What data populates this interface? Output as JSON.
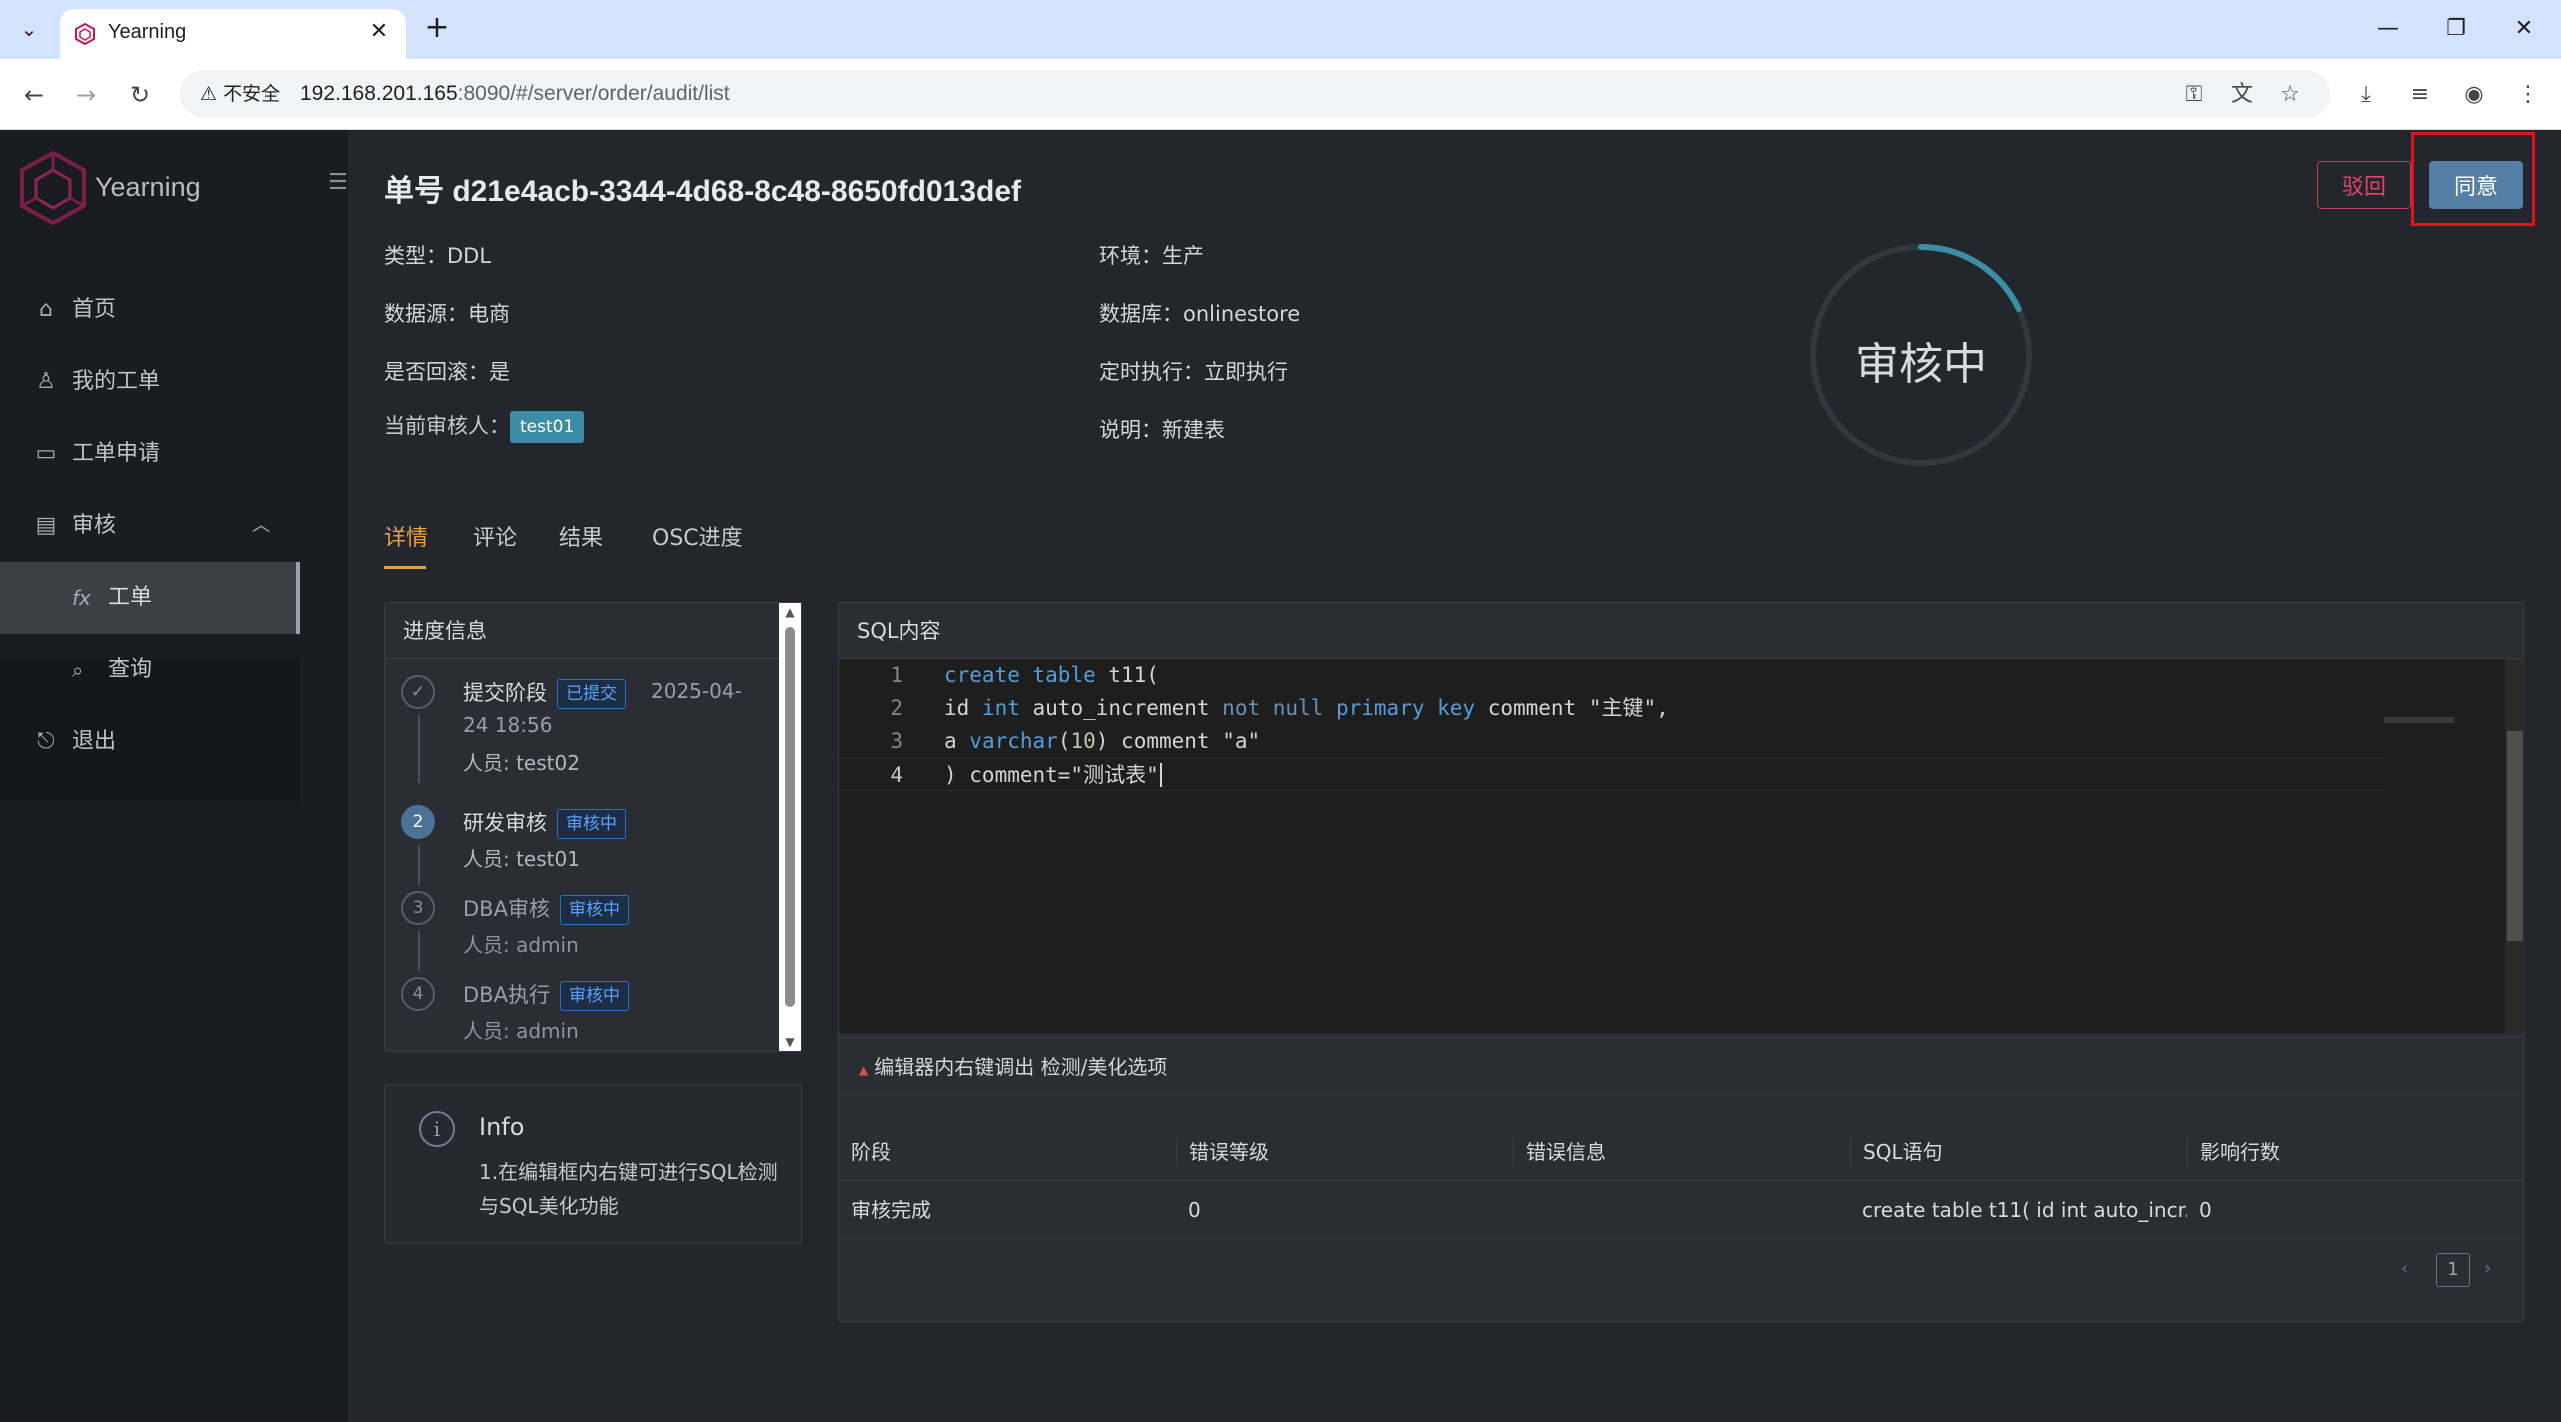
{
  "browser": {
    "tab_title": "Yearning",
    "insecure_label": "不安全",
    "url_host": "192.168.201.165",
    "url_rest": ":8090/#/server/order/audit/list"
  },
  "sidebar": {
    "brand": "Yearning",
    "items": [
      {
        "label": "首页",
        "icon": "home-icon"
      },
      {
        "label": "我的工单",
        "icon": "user-icon"
      },
      {
        "label": "工单申请",
        "icon": "monitor-icon"
      },
      {
        "label": "审核",
        "icon": "clipboard-icon"
      }
    ],
    "sub_items": [
      {
        "label": "工单",
        "icon": "fx-icon",
        "glyph": "fx"
      },
      {
        "label": "查询",
        "icon": "search-icon"
      }
    ],
    "logout": "退出"
  },
  "order": {
    "title": "单号 d21e4acb-3344-4d68-8c48-8650fd013def",
    "reject_label": "驳回",
    "agree_label": "同意",
    "fields": {
      "type": "类型：DDL",
      "env": "环境：生产",
      "source": "数据源：电商",
      "database": "数据库：onlinestore",
      "rollback": "是否回滚：是",
      "schedule": "定时执行：立即执行",
      "assignee_label": "当前审核人：",
      "assignee": "test01",
      "desc": "说明：新建表"
    },
    "status": "审核中",
    "status_progress": 0.18,
    "accent": "#3c8ea3"
  },
  "tabs": [
    "详情",
    "评论",
    "结果",
    "OSC进度"
  ],
  "progress": {
    "title": "进度信息",
    "steps": [
      {
        "num": "✓",
        "title": "提交阶段",
        "badge": "已提交",
        "time_a": "2025-04-",
        "time_b": "24 18:56",
        "user": "人员: test02"
      },
      {
        "num": "2",
        "title": "研发审核",
        "badge": "审核中",
        "user": "人员: test01"
      },
      {
        "num": "3",
        "title": "DBA审核",
        "badge": "审核中",
        "user": "人员: admin"
      },
      {
        "num": "4",
        "title": "DBA执行",
        "badge": "审核中",
        "user": "人员: admin"
      }
    ]
  },
  "info": {
    "title": "Info",
    "text": "1.在编辑框内右键可进行SQL检测与SQL美化功能"
  },
  "sql": {
    "title": "SQL内容",
    "line_numbers": [
      "1",
      "2",
      "3",
      "4"
    ],
    "hint": "编辑器内右键调出 检测/美化选项",
    "columns": [
      "阶段",
      "错误等级",
      "错误信息",
      "SQL语句",
      "影响行数"
    ],
    "row": [
      "审核完成",
      "0",
      "",
      "create table t11( id int auto_incr...",
      "0"
    ],
    "page": "1"
  }
}
